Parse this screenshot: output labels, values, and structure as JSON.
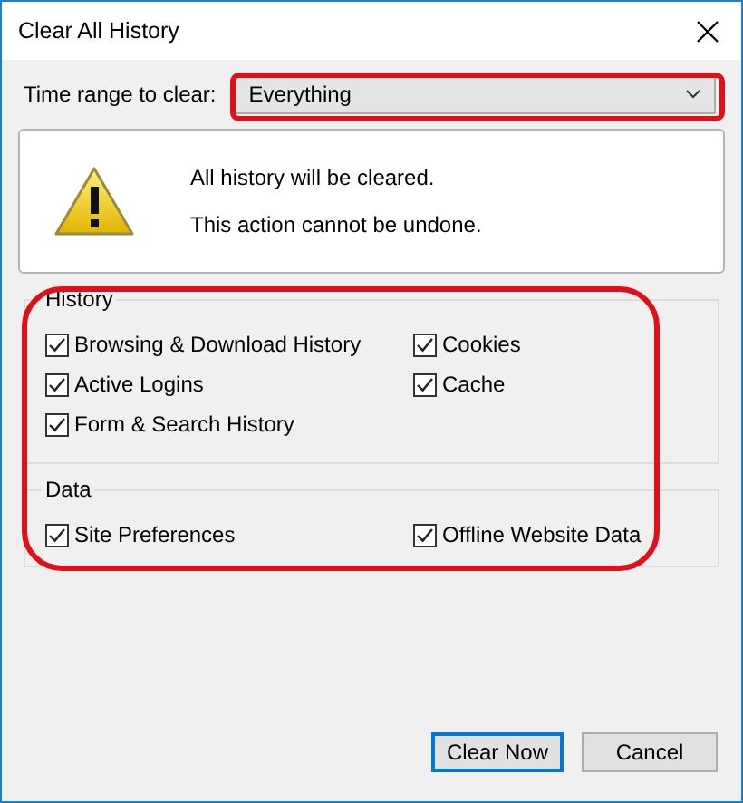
{
  "window": {
    "title": "Clear All History"
  },
  "time_range": {
    "label": "Time range to clear:",
    "value": "Everything"
  },
  "warning": {
    "lines": [
      "All history will be cleared.",
      "This action cannot be undone."
    ]
  },
  "groups": [
    {
      "title": "History",
      "items": [
        {
          "label": "Browsing & Download History",
          "checked": true
        },
        {
          "label": "Cookies",
          "checked": true
        },
        {
          "label": "Active Logins",
          "checked": true
        },
        {
          "label": "Cache",
          "checked": true
        },
        {
          "label": "Form & Search History",
          "checked": true
        }
      ]
    },
    {
      "title": "Data",
      "items": [
        {
          "label": "Site Preferences",
          "checked": true
        },
        {
          "label": "Offline Website Data",
          "checked": true
        }
      ]
    }
  ],
  "buttons": [
    {
      "label": "Clear Now",
      "default": true
    },
    {
      "label": "Cancel",
      "default": false
    }
  ]
}
